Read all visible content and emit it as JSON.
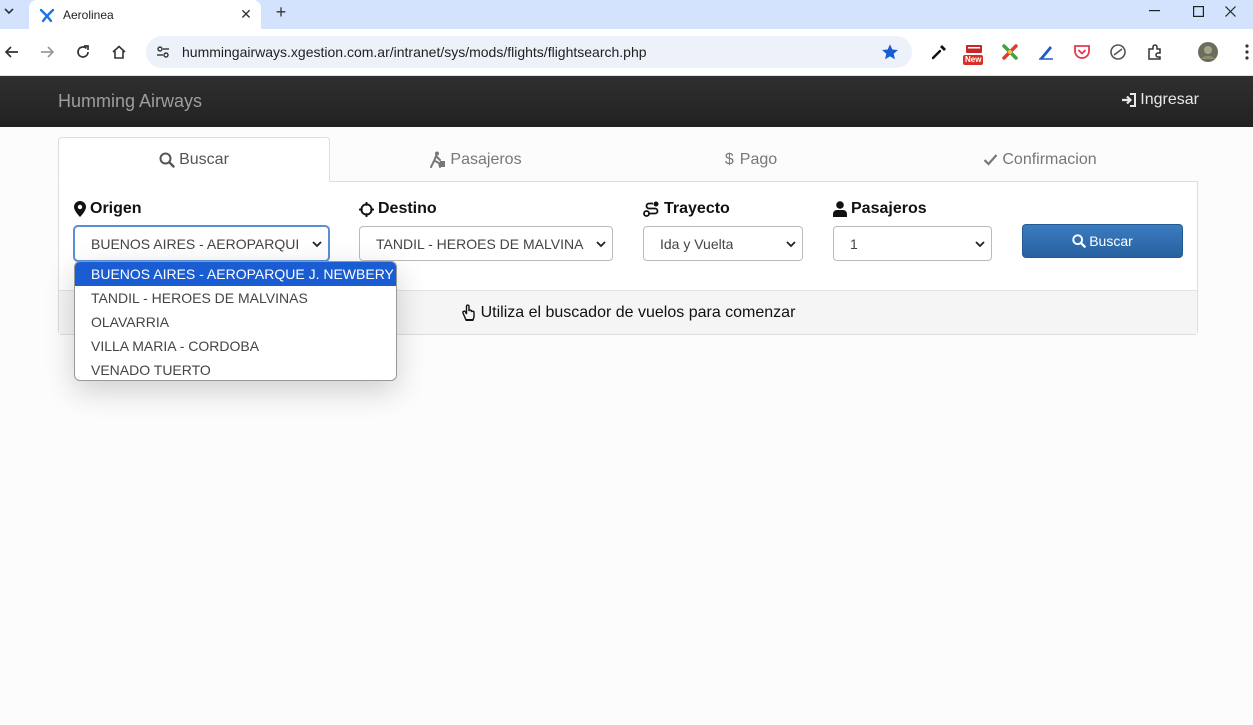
{
  "browser": {
    "tab_title": "Aerolinea",
    "url": "hummingairways.xgestion.com.ar/intranet/sys/mods/flights/flightsearch.php",
    "new_badge": "New"
  },
  "navbar": {
    "brand": "Humming Airways",
    "login_label": "Ingresar"
  },
  "wizard": {
    "tabs": [
      {
        "label": "Buscar",
        "icon": "search-icon",
        "active": true
      },
      {
        "label": "Pasajeros",
        "icon": "luggage-person-icon",
        "active": false
      },
      {
        "label": "Pago",
        "icon": "dollar-icon",
        "active": false
      },
      {
        "label": "Confirmacion",
        "icon": "check-icon",
        "active": false
      }
    ]
  },
  "search": {
    "origen": {
      "label": "Origen",
      "value": "BUENOS AIRES - AEROPARQUE J. NEWBERY",
      "display": "BUENOS AIRES - AEROPARQUI"
    },
    "destino": {
      "label": "Destino",
      "value": "TANDIL - HEROES DE MALVINAS",
      "display": "TANDIL - HEROES DE MALVINA"
    },
    "trayecto": {
      "label": "Trayecto",
      "value": "Ida y Vuelta"
    },
    "pasajeros": {
      "label": "Pasajeros",
      "value": "1"
    },
    "button_label": "Buscar",
    "info_message": "Utiliza el buscador de vuelos para comenzar"
  },
  "origen_dropdown": {
    "options": [
      "BUENOS AIRES - AEROPARQUE J. NEWBERY",
      "TANDIL - HEROES DE MALVINAS",
      "OLAVARRIA",
      "VILLA MARIA - CORDOBA",
      "VENADO TUERTO"
    ],
    "selected_index": 0
  },
  "colors": {
    "navbar_bg": "#262626",
    "primary_button": "#2b6cad",
    "option_highlight": "#1a5cd1",
    "tab_strip": "#d3e3fd"
  }
}
